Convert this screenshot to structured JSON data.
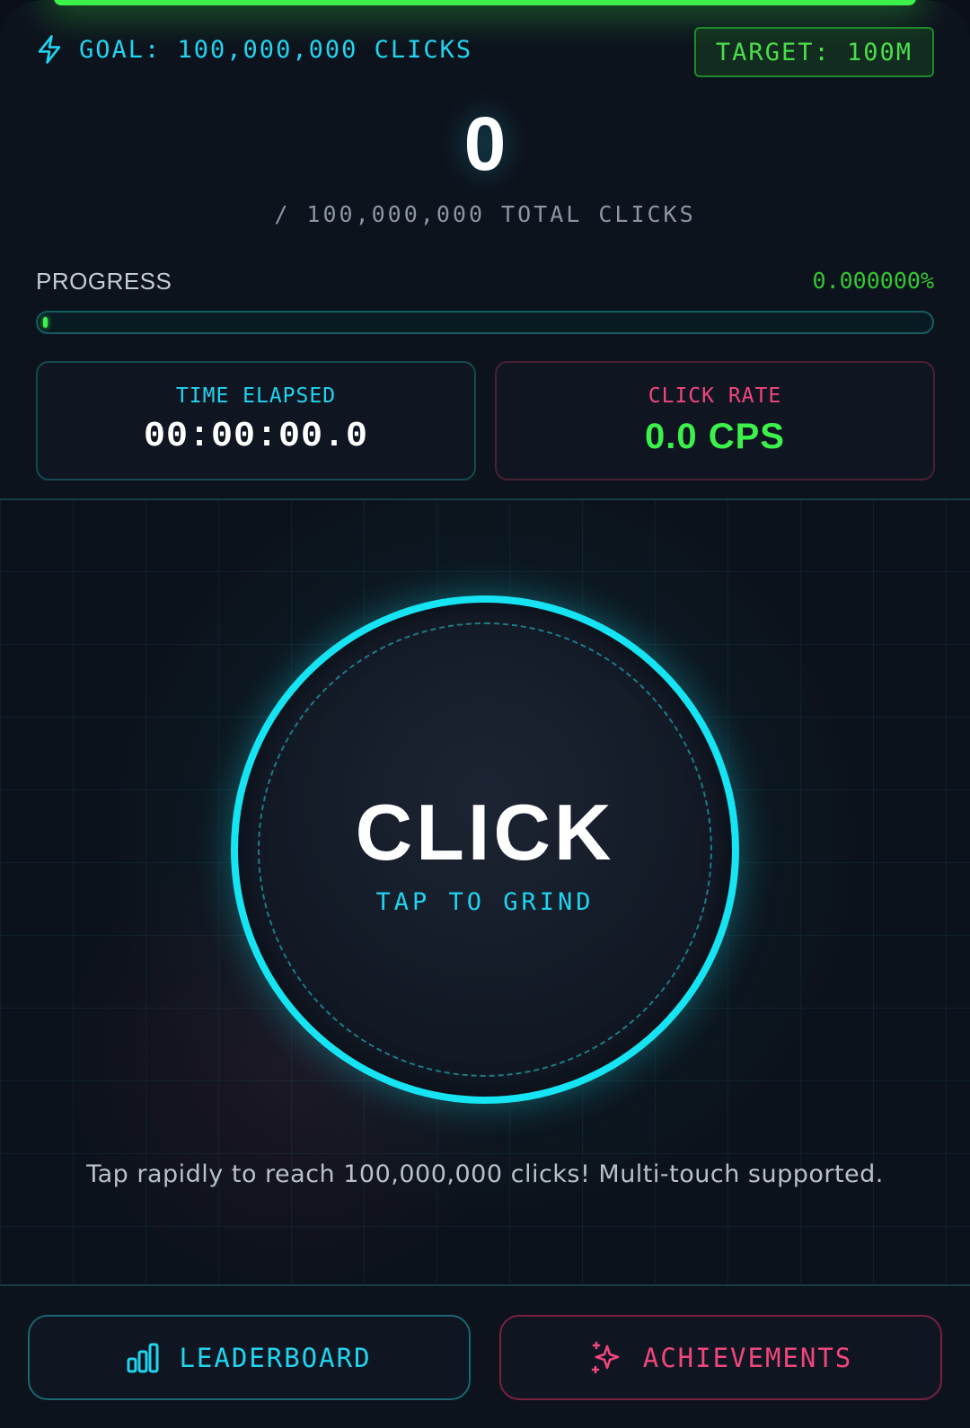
{
  "header": {
    "goal_text": "GOAL: 100,000,000 CLICKS",
    "goal_icon": "lightning-icon",
    "target_badge": "TARGET: 100M"
  },
  "counter": {
    "value": "0",
    "subtitle": "/ 100,000,000 TOTAL CLICKS"
  },
  "progress": {
    "label": "PROGRESS",
    "percent_text": "0.000000%",
    "fraction": 0.0
  },
  "stats": {
    "time_label": "TIME ELAPSED",
    "time_value": "00:00:00.0",
    "rate_label": "CLICK RATE",
    "rate_value": "0.0 CPS"
  },
  "click_button": {
    "label": "CLICK",
    "sublabel": "TAP TO GRIND"
  },
  "hint": "Tap rapidly to reach 100,000,000 clicks! Multi-touch supported.",
  "footer": {
    "leaderboard_label": "LEADERBOARD",
    "leaderboard_icon": "bar-chart-icon",
    "achievements_label": "ACHIEVEMENTS",
    "achievements_icon": "sparkles-icon"
  },
  "colors": {
    "accent_cyan": "#22d3ee",
    "accent_green": "#3cf24a",
    "accent_pink": "#f0467c",
    "background": "#0d131d"
  }
}
